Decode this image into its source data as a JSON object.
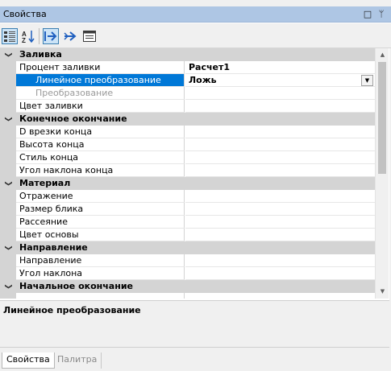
{
  "window": {
    "title": "Свойства",
    "restore_glyph": "□",
    "pin_glyph": "ᛘ"
  },
  "toolbar": {
    "buttons": [
      {
        "name": "categorized-button",
        "icon": "categorized-icon",
        "pressed": true
      },
      {
        "name": "alphabetical-button",
        "icon": "sort-az-icon",
        "pressed": false,
        "label": "A↓"
      },
      {
        "name": "events-button",
        "icon": "arrow-in-icon",
        "pressed": true
      },
      {
        "name": "properties-nav-button",
        "icon": "arrow-right-icon",
        "pressed": false
      },
      {
        "name": "property-pages-button",
        "icon": "property-pages-icon",
        "pressed": false
      }
    ]
  },
  "grid": {
    "collapse_glyph": "❯",
    "categories": [
      {
        "name": "Заливка",
        "properties": [
          {
            "name": "Процент заливки",
            "value": "Расчет1",
            "value_bold": true
          },
          {
            "name": "Линейное преобразование",
            "value": "Ложь",
            "value_bold": true,
            "selected": true,
            "child": true,
            "dropdown": true
          },
          {
            "name": "Преобразование",
            "value": "",
            "disabled": true,
            "child": true
          },
          {
            "name": "Цвет заливки",
            "value": ""
          }
        ]
      },
      {
        "name": "Конечное окончание",
        "properties": [
          {
            "name": "D врезки конца",
            "value": ""
          },
          {
            "name": "Высота конца",
            "value": ""
          },
          {
            "name": "Стиль конца",
            "value": ""
          },
          {
            "name": "Угол наклона конца",
            "value": ""
          }
        ]
      },
      {
        "name": "Материал",
        "properties": [
          {
            "name": "Отражение",
            "value": ""
          },
          {
            "name": "Размер блика",
            "value": ""
          },
          {
            "name": "Рассеяние",
            "value": ""
          },
          {
            "name": "Цвет основы",
            "value": ""
          }
        ]
      },
      {
        "name": "Направление",
        "properties": [
          {
            "name": "Направление",
            "value": ""
          },
          {
            "name": "Угол наклона",
            "value": ""
          }
        ]
      },
      {
        "name": "Начальное окончание",
        "properties": [
          {
            "name": "",
            "value": ""
          }
        ]
      }
    ],
    "scroll_up_glyph": "▲",
    "scroll_down_glyph": "▼"
  },
  "description": {
    "title": "Линейное преобразование"
  },
  "tabs": [
    {
      "label": "Свойства",
      "active": true
    },
    {
      "label": "Палитра",
      "active": false
    }
  ],
  "colors": {
    "title_bar": "#aec6e4",
    "selection": "#0078d7",
    "category": "#d4d4d4"
  }
}
